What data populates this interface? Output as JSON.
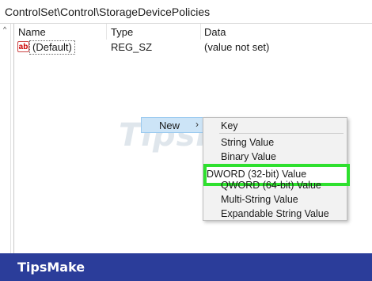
{
  "address_bar": {
    "path": "ControlSet\\Control\\StorageDevicePolicies"
  },
  "list": {
    "columns": [
      "Name",
      "Type",
      "Data"
    ],
    "rows": [
      {
        "icon": "ab",
        "name": "(Default)",
        "type": "REG_SZ",
        "data": "(value not set)"
      }
    ]
  },
  "context_menu": {
    "new_label": "New",
    "submenu": {
      "items": [
        "Key",
        "String Value",
        "Binary Value",
        "DWORD (32-bit) Value",
        "QWORD (64-bit) Value",
        "Multi-String Value",
        "Expandable String Value"
      ],
      "highlighted_item": "DWORD (32-bit) Value"
    }
  },
  "watermark": "TipsMake",
  "footer": {
    "brand": "TipsMake"
  },
  "colors": {
    "highlight_border": "#2ee02e",
    "menu_hover": "#cce4f7",
    "footer_bg": "#2b3d9a",
    "string_icon": "#c00000"
  },
  "icons": [
    "scroll-up-caret-icon",
    "string-value-icon",
    "submenu-arrow-icon"
  ]
}
